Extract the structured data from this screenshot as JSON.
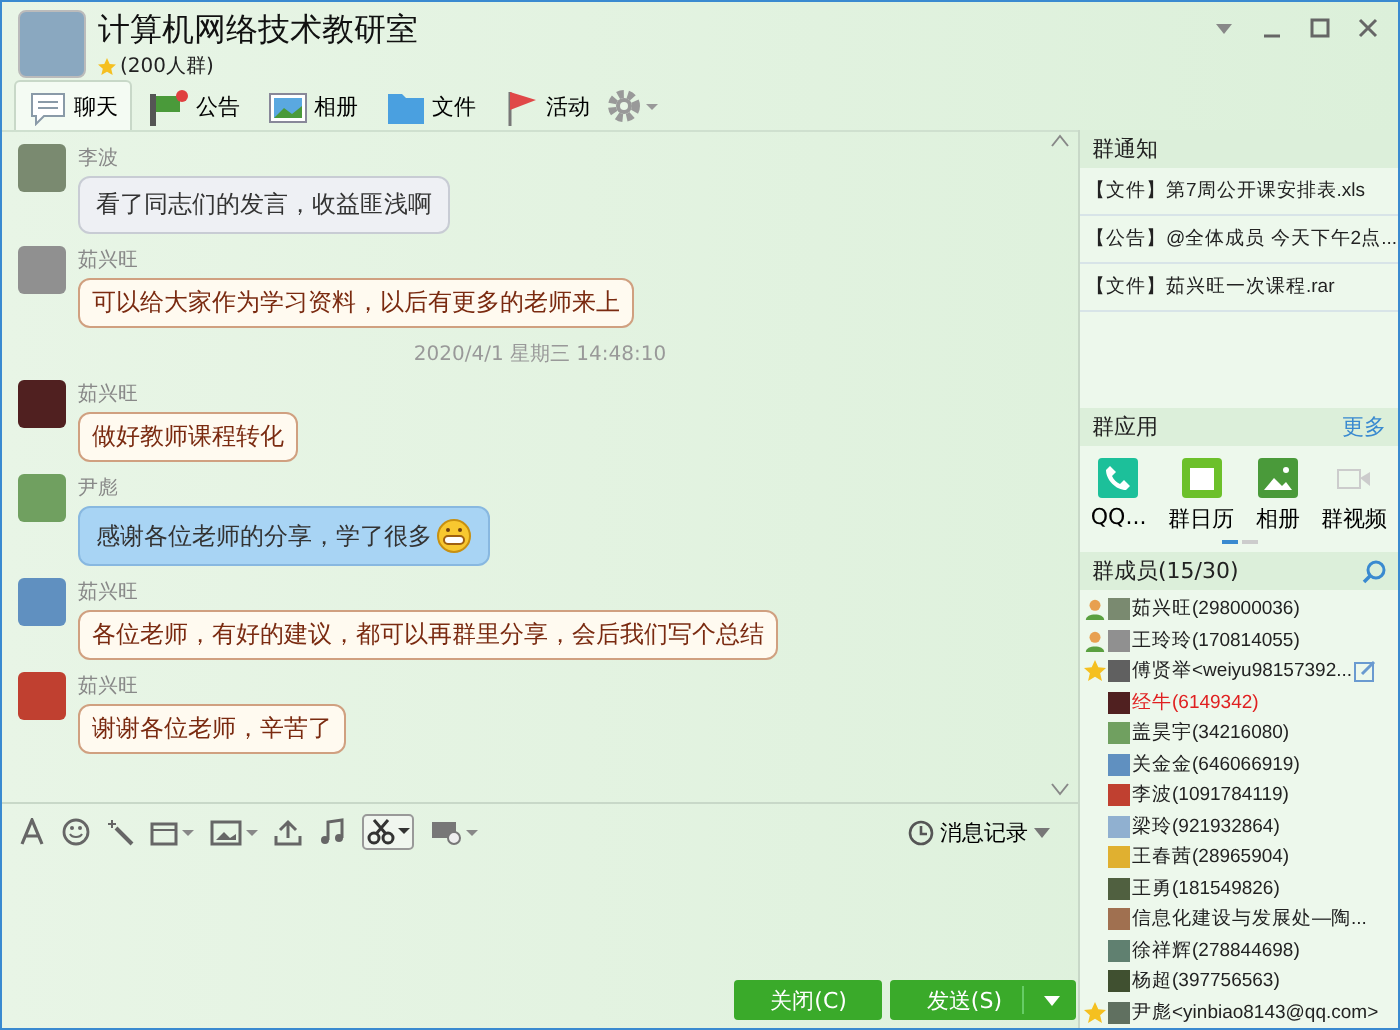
{
  "window": {
    "title": "计算机网络技术教研室",
    "subtitle": "(200人群)"
  },
  "tabs": [
    {
      "label": "聊天",
      "selected": true
    },
    {
      "label": "公告",
      "selected": false
    },
    {
      "label": "相册",
      "selected": false
    },
    {
      "label": "文件",
      "selected": false
    },
    {
      "label": "活动",
      "selected": false
    }
  ],
  "messages": [
    {
      "kind": "plain",
      "sender": "李波",
      "text": "看了同志们的发言，收益匪浅啊",
      "emoji": false
    },
    {
      "kind": "themed",
      "sender": "茹兴旺",
      "text": "可以给大家作为学习资料，以后有更多的老师来上",
      "emoji": false
    },
    {
      "kind": "timestamp",
      "text": "2020/4/1 星期三 14:48:10"
    },
    {
      "kind": "themed",
      "sender": "茹兴旺",
      "text": "做好教师课程转化",
      "emoji": false
    },
    {
      "kind": "own",
      "sender": "尹彪",
      "text": "感谢各位老师的分享，学了很多",
      "emoji": true
    },
    {
      "kind": "themed",
      "sender": "茹兴旺",
      "text": "各位老师，有好的建议，都可以再群里分享，会后我们写个总结",
      "emoji": false
    },
    {
      "kind": "themed",
      "sender": "茹兴旺",
      "text": "谢谢各位老师，辛苦了",
      "emoji": false
    }
  ],
  "history_button": "消息记录",
  "buttons": [
    {
      "label": "关闭(C)",
      "kind": "plain"
    },
    {
      "label": "发送(S)",
      "kind": "split"
    }
  ],
  "notices": {
    "title": "群通知",
    "items": [
      "【文件】第7周公开课安排表.xls",
      "【公告】@全体成员 今天下午2点...",
      "【文件】茹兴旺一次课程.rar"
    ]
  },
  "apps": {
    "title": "群应用",
    "more": "更多",
    "items": [
      {
        "label": "QQ..."
      },
      {
        "label": "群日历"
      },
      {
        "label": "相册"
      },
      {
        "label": "群视频"
      }
    ]
  },
  "members": {
    "title": "群成员(15/30)",
    "items": [
      {
        "name": "茹兴旺(298000036)",
        "kind": "owner",
        "highlighted": false,
        "hovered": false
      },
      {
        "name": "王玲玲(170814055)",
        "kind": "owner",
        "highlighted": false,
        "hovered": false
      },
      {
        "name": "傅贤举<weiyu98157392...",
        "kind": "admin",
        "highlighted": false,
        "hovered": true
      },
      {
        "name": "经牛(6149342)",
        "kind": "member",
        "highlighted": true,
        "hovered": false
      },
      {
        "name": "盖昊宇(34216080)",
        "kind": "member",
        "highlighted": false,
        "hovered": false
      },
      {
        "name": "关金金(646066919)",
        "kind": "member",
        "highlighted": false,
        "hovered": false
      },
      {
        "name": "李波(1091784119)",
        "kind": "member",
        "highlighted": false,
        "hovered": false
      },
      {
        "name": "梁玲(921932864)",
        "kind": "member",
        "highlighted": false,
        "hovered": false
      },
      {
        "name": "王春茜(28965904)",
        "kind": "member",
        "highlighted": false,
        "hovered": false
      },
      {
        "name": "王勇(181549826)",
        "kind": "member",
        "highlighted": false,
        "hovered": false
      },
      {
        "name": "信息化建设与发展处—陶...",
        "kind": "member",
        "highlighted": false,
        "hovered": false
      },
      {
        "name": "徐祥辉(278844698)",
        "kind": "member",
        "highlighted": false,
        "hovered": false
      },
      {
        "name": "杨超(397756563)",
        "kind": "member",
        "highlighted": false,
        "hovered": false
      },
      {
        "name": "尹彪<yinbiao8143@qq.com>",
        "kind": "admin",
        "highlighted": false,
        "hovered": false
      }
    ]
  }
}
